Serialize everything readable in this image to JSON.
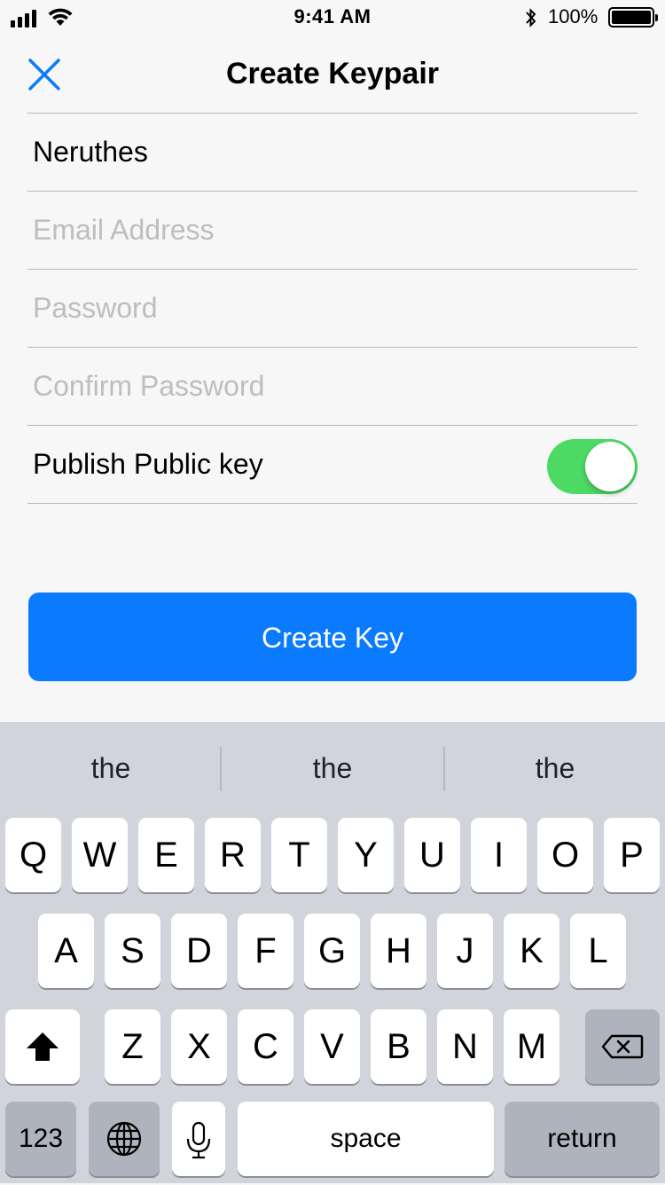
{
  "status_bar": {
    "time": "9:41 AM",
    "battery": "100%",
    "icons": [
      "signal-icon",
      "wifi-icon",
      "bluetooth-icon",
      "battery-icon"
    ]
  },
  "nav": {
    "title": "Create Keypair",
    "close_icon": "close-icon"
  },
  "form": {
    "name_value": "Neruthes",
    "email_placeholder": "Email Address",
    "password_placeholder": "Password",
    "confirm_placeholder": "Confirm Password",
    "publish_label": "Publish Public key",
    "publish_on": true
  },
  "create_button": "Create Key",
  "colors": {
    "accent": "#0a7aff",
    "toggle_on": "#4cd964",
    "background": "#f7f7f7",
    "keyboard": "#d1d4da"
  },
  "keyboard": {
    "suggestions": [
      "the",
      "the",
      "the"
    ],
    "row1": [
      "Q",
      "W",
      "E",
      "R",
      "T",
      "Y",
      "U",
      "I",
      "O",
      "P"
    ],
    "row2": [
      "A",
      "S",
      "D",
      "F",
      "G",
      "H",
      "J",
      "K",
      "L"
    ],
    "row3": [
      "Z",
      "X",
      "C",
      "V",
      "B",
      "N",
      "M"
    ],
    "numbers_key": "123",
    "space_key": "space",
    "return_key": "return"
  }
}
